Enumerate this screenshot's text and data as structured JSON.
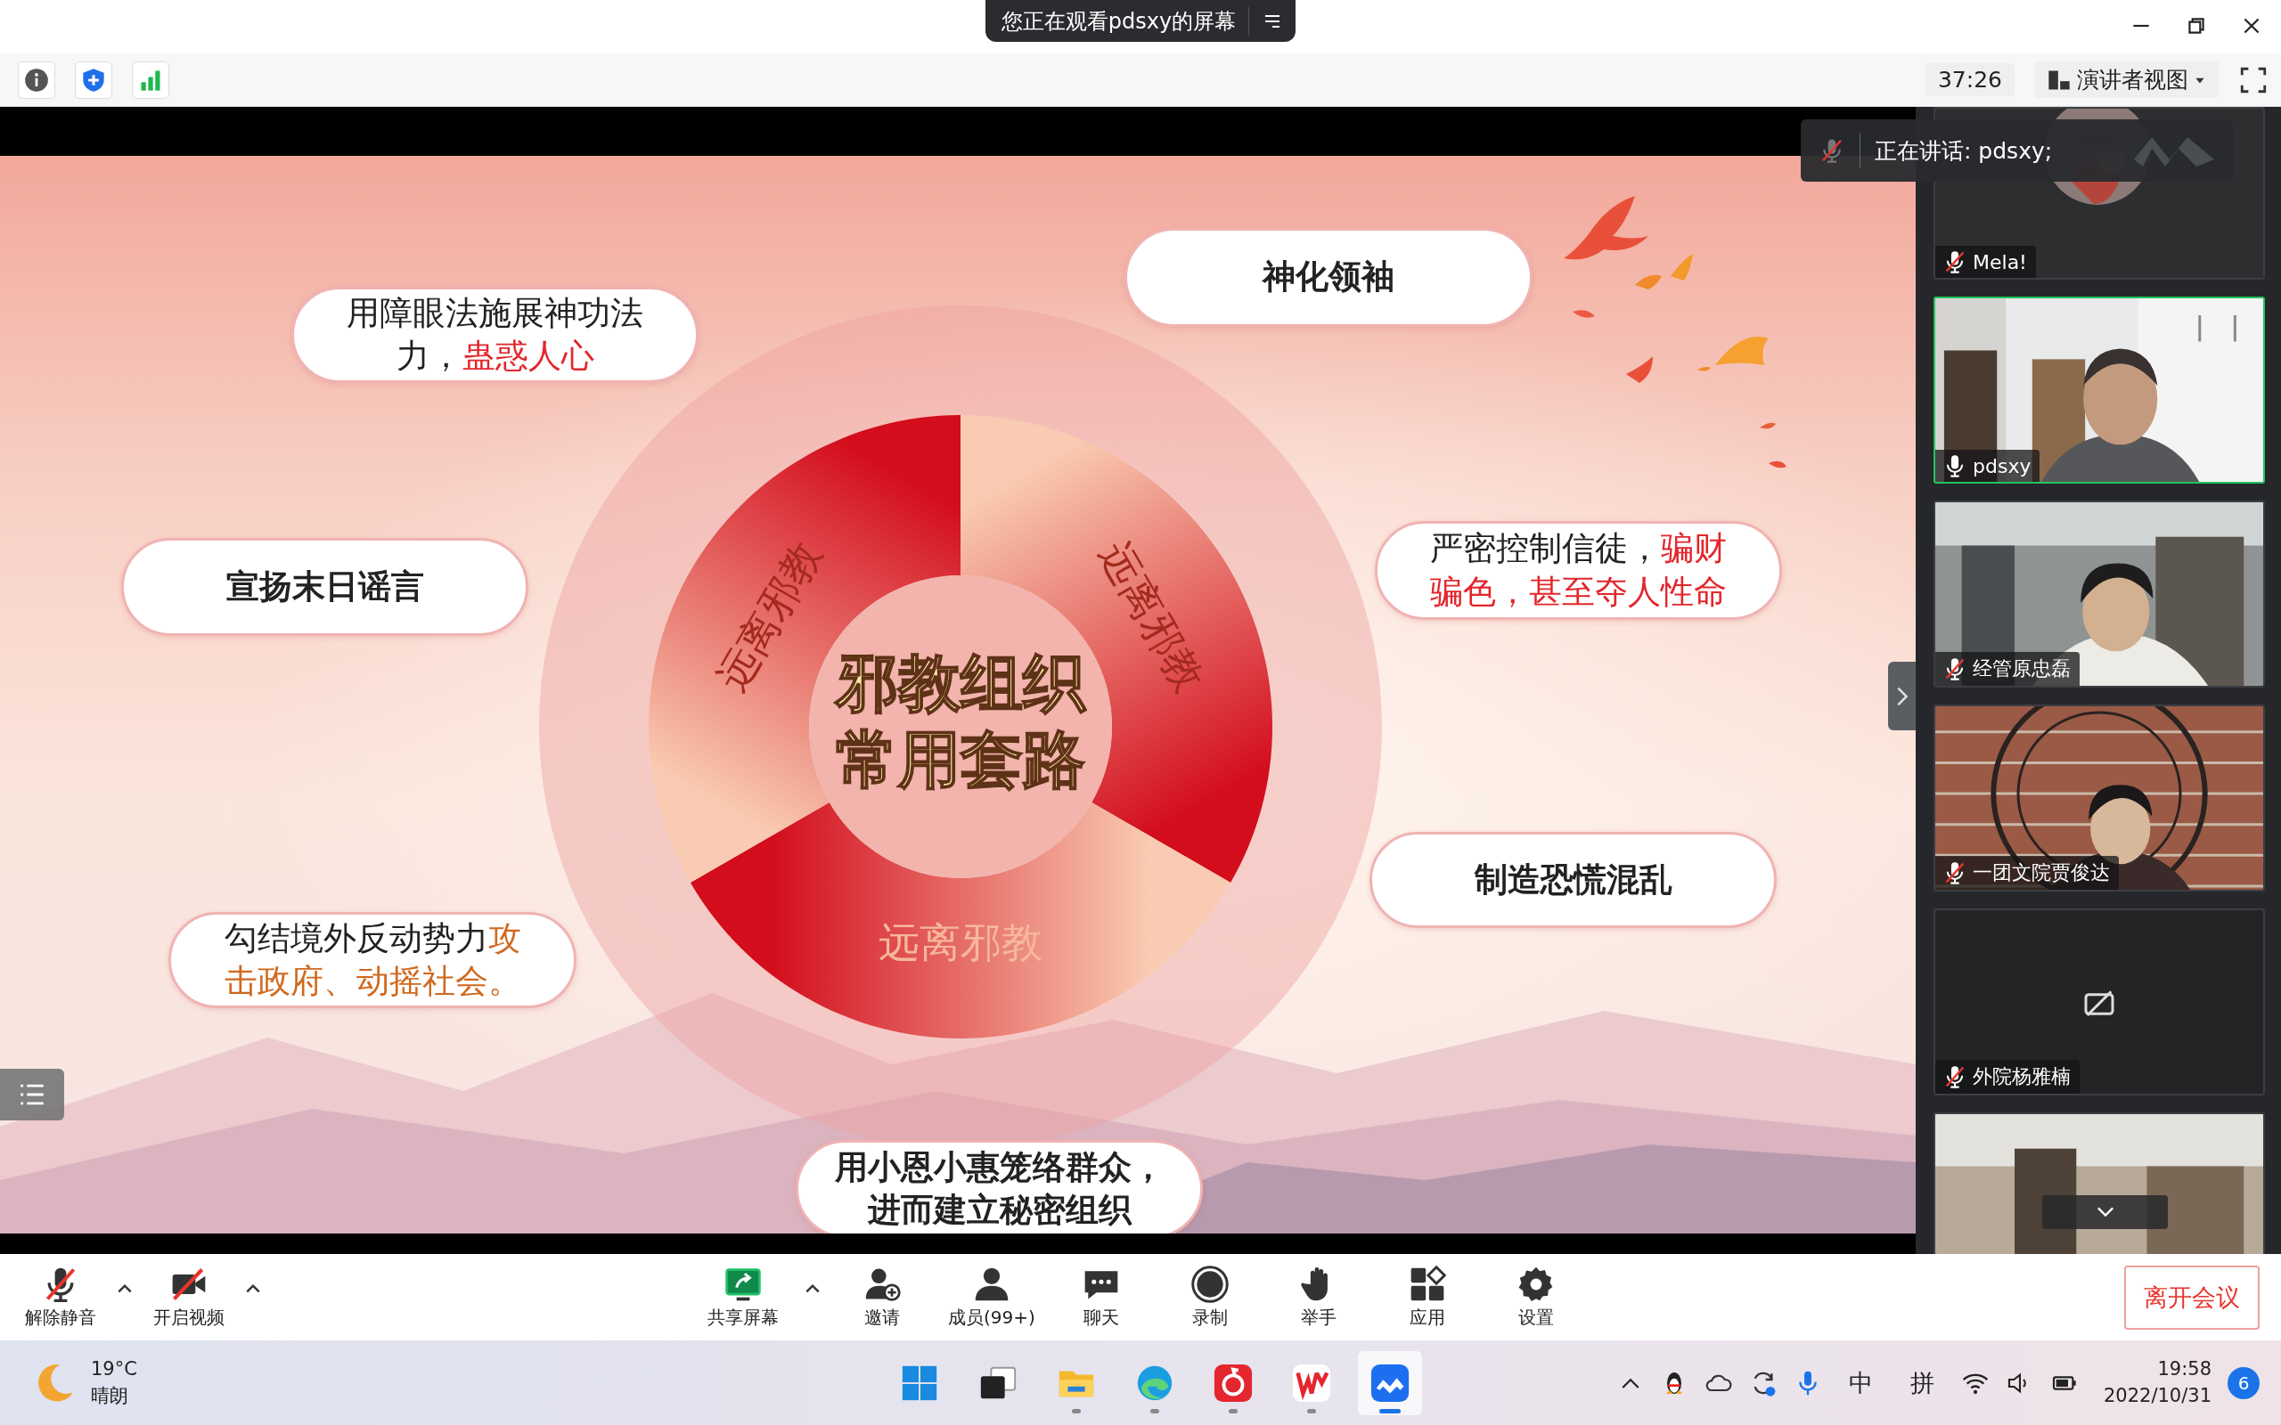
{
  "title_bar": {
    "banner": "您正在观看pdsxy的屏幕"
  },
  "info_bar": {
    "timer": "37:26",
    "view_mode": "演讲者视图"
  },
  "slide": {
    "diagram": {
      "title_lines": [
        "邪教组织",
        "常用套路"
      ],
      "segments": [
        {
          "label": "远离邪教"
        },
        {
          "label": "远离邪教"
        },
        {
          "label": "远离邪教"
        }
      ]
    },
    "callouts": [
      {
        "bold": false,
        "parts": [
          {
            "text": "用障眼法施展神功法力，"
          },
          {
            "text": "蛊惑人心",
            "color": "#e3262c"
          }
        ]
      },
      {
        "bold": true,
        "parts": [
          {
            "text": "神化领袖"
          }
        ]
      },
      {
        "bold": true,
        "parts": [
          {
            "text": "宣扬末日谣言"
          }
        ]
      },
      {
        "bold": false,
        "parts": [
          {
            "text": "严密控制信徒，"
          },
          {
            "text": "骗财骗色，甚至夺人性命",
            "color": "#e3262c"
          }
        ]
      },
      {
        "bold": false,
        "parts": [
          {
            "text": "勾结境外反动势力"
          },
          {
            "text": "攻击政府、动摇社会。",
            "color": "#d0681e"
          }
        ]
      },
      {
        "bold": true,
        "parts": [
          {
            "text": "制造恐慌混乱"
          }
        ]
      },
      {
        "bold": true,
        "parts": [
          {
            "text": "用小恩小惠笼络群众，进而建立秘密组织"
          }
        ]
      }
    ]
  },
  "speaking": {
    "label": "正在讲话: pdsxy;"
  },
  "participants": [
    {
      "name": "Mela!",
      "kind": "avatar",
      "muted": true,
      "speaking": false
    },
    {
      "name": "pdsxy",
      "kind": "camera",
      "muted": false,
      "speaking": true
    },
    {
      "name": "经管原忠磊",
      "kind": "camera",
      "muted": true,
      "speaking": false
    },
    {
      "name": "一团文院贾俊达",
      "kind": "camera",
      "muted": true,
      "speaking": false
    },
    {
      "name": "外院杨雅楠",
      "kind": "off",
      "muted": true,
      "speaking": false
    },
    {
      "kind": "camera",
      "speaking": false
    }
  ],
  "toolbar": {
    "left": [
      {
        "label": "解除静音",
        "kind": "mic-off",
        "caret": true
      },
      {
        "label": "开启视频",
        "kind": "video-off",
        "caret": true
      }
    ],
    "center": [
      {
        "label": "共享屏幕",
        "kind": "share",
        "caret": true
      },
      {
        "label": "邀请",
        "kind": "invite",
        "caret": false
      },
      {
        "label": "成员(99+)",
        "kind": "members",
        "caret": false
      },
      {
        "label": "聊天",
        "kind": "chat",
        "caret": false
      },
      {
        "label": "录制",
        "kind": "record",
        "caret": false
      },
      {
        "label": "举手",
        "kind": "hand",
        "caret": false
      },
      {
        "label": "应用",
        "kind": "apps",
        "caret": false
      },
      {
        "label": "设置",
        "kind": "settings",
        "caret": false
      }
    ],
    "leave_button": "离开会议"
  },
  "taskbar": {
    "weather": {
      "temperature": "19°C",
      "condition": "晴朗"
    },
    "apps": [
      {
        "kind": "start",
        "running": false,
        "selected": false
      },
      {
        "kind": "task-view",
        "running": false,
        "selected": false
      },
      {
        "kind": "files",
        "running": true,
        "selected": false
      },
      {
        "kind": "browser",
        "running": true,
        "selected": false
      },
      {
        "kind": "music",
        "running": true,
        "selected": false
      },
      {
        "kind": "office",
        "running": true,
        "selected": false
      },
      {
        "kind": "meeting",
        "running": true,
        "selected": true
      }
    ],
    "tray_ime": [
      "中",
      "拼"
    ],
    "time": "19:58",
    "date": "2022/10/31",
    "notifications": "6"
  }
}
